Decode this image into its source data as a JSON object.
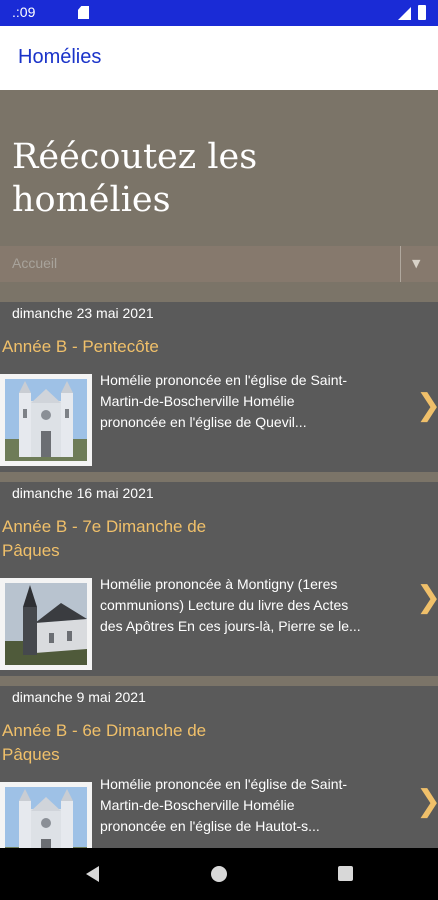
{
  "status_bar": {
    "time": ".:09"
  },
  "app_bar": {
    "title": "Homélies"
  },
  "hero": {
    "title_line1": "Réécoutez les",
    "title_line2": "homélies"
  },
  "dropdown": {
    "selected": "Accueil"
  },
  "posts": [
    {
      "date": "dimanche 23 mai 2021",
      "title_line1": "Année B - Pentecôte",
      "title_line2": "",
      "thumbnail": "church-facade-image",
      "excerpt_line1": "Homélie prononcée en l'église de Saint-",
      "excerpt_line2": "Martin-de-Boscherville       Homélie",
      "excerpt_line3": "prononcée en l'église de Quevil..."
    },
    {
      "date": "dimanche 16 mai 2021",
      "title_line1": "Année B - 7e Dimanche de",
      "title_line2": "Pâques",
      "thumbnail": "village-church-image",
      "excerpt_line1": " Homélie prononcée à Montigny (1eres",
      "excerpt_line2": "communions)     Lecture du livre des Actes",
      "excerpt_line3": "des Apôtres En ces jours-là, Pierre se le..."
    },
    {
      "date": "dimanche 9 mai 2021",
      "title_line1": "Année B - 6e Dimanche de",
      "title_line2": "Pâques",
      "thumbnail": "church-facade-image",
      "excerpt_line1": " Homélie prononcée en l'église de Saint-",
      "excerpt_line2": "Martin-de-Boscherville          Homélie",
      "excerpt_line3": "prononcée en l'église de Hautot-s..."
    }
  ],
  "colors": {
    "status_bar": "#1a2bd6",
    "app_title": "#1a33c9",
    "hero_bg": "#7b7468",
    "post_bg": "#5a5a5a",
    "accent_title": "#f0c06a"
  }
}
